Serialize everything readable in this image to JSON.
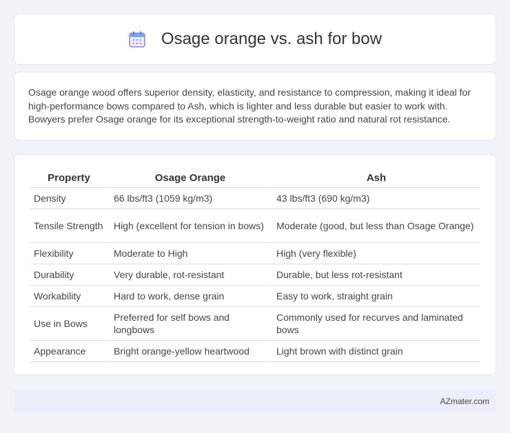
{
  "header": {
    "title": "Osage orange vs. ash for bow",
    "icon": "calendar-icon",
    "icon_color": "#7c6ee6"
  },
  "description": "Osage orange wood offers superior density, elasticity, and resistance to compression, making it ideal for high-performance bows compared to Ash, which is lighter and less durable but easier to work with. Bowyers prefer Osage orange for its exceptional strength-to-weight ratio and natural rot resistance.",
  "table": {
    "headers": [
      "Property",
      "Osage Orange",
      "Ash"
    ],
    "rows": [
      [
        "Density",
        "66 lbs/ft3 (1059 kg/m3)",
        "43 lbs/ft3 (690 kg/m3)"
      ],
      [
        "Tensile Strength",
        "High (excellent for tension in bows)",
        "Moderate (good, but less than Osage Orange)"
      ],
      [
        "Flexibility",
        "Moderate to High",
        "High (very flexible)"
      ],
      [
        "Durability",
        "Very durable, rot-resistant",
        "Durable, but less rot-resistant"
      ],
      [
        "Workability",
        "Hard to work, dense grain",
        "Easy to work, straight grain"
      ],
      [
        "Use in Bows",
        "Preferred for self bows and longbows",
        "Commonly used for recurves and laminated bows"
      ],
      [
        "Appearance",
        "Bright orange-yellow heartwood",
        "Light brown with distinct grain"
      ]
    ]
  },
  "footer": {
    "text": "AZmater.com"
  }
}
